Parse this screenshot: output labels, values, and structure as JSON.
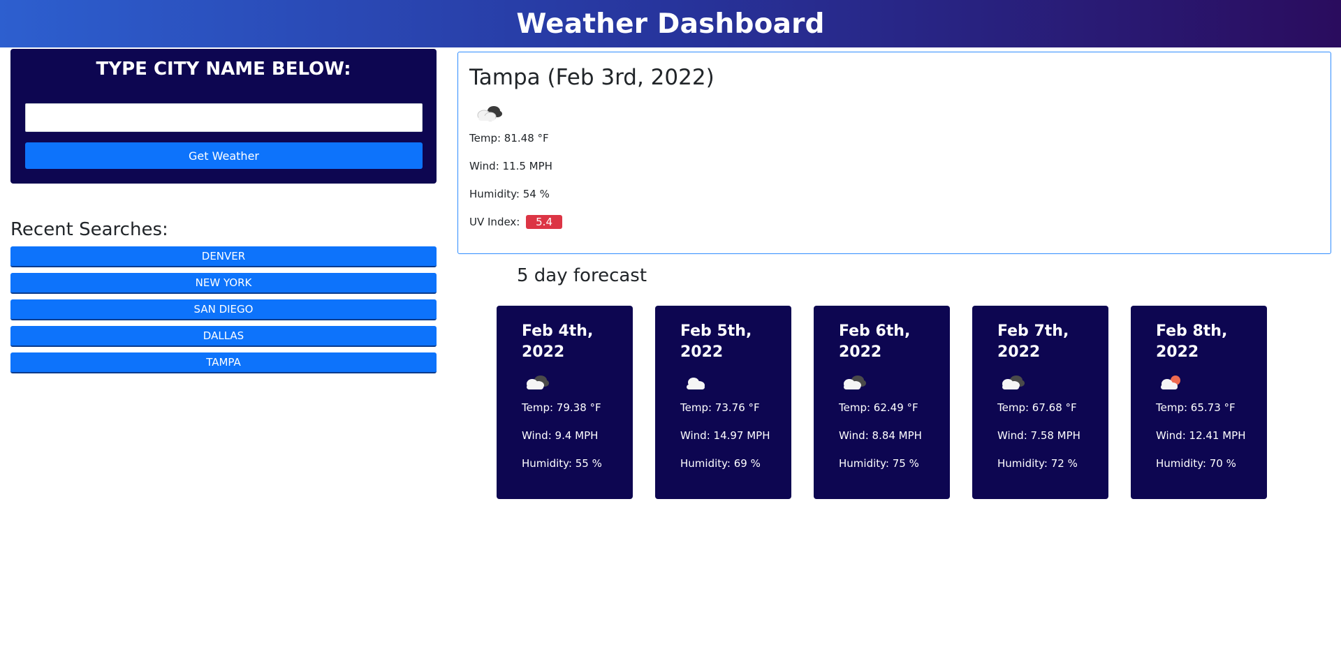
{
  "header": {
    "title": "Weather Dashboard"
  },
  "search": {
    "title": "TYPE CITY NAME BELOW:",
    "input_value": "",
    "button_label": "Get Weather"
  },
  "recent": {
    "title": "Recent Searches:",
    "items": [
      "DENVER",
      "NEW YORK",
      "SAN DIEGO",
      "DALLAS",
      "TAMPA"
    ]
  },
  "current": {
    "city_date": "Tampa (Feb 3rd, 2022)",
    "icon": "partly-cloudy-night-icon",
    "temp": "Temp: 81.48 °F",
    "wind": "Wind: 11.5 MPH",
    "humidity": "Humidity: 54 %",
    "uv_label": "UV Index:",
    "uv_value": "5.4",
    "uv_color": "#dc3545"
  },
  "forecast": {
    "title": "5 day forecast",
    "days": [
      {
        "date": "Feb 4th, 2022",
        "icon": "broken-clouds-icon",
        "temp": "Temp: 79.38 °F",
        "wind": "Wind: 9.4 MPH",
        "humidity": "Humidity: 55 %"
      },
      {
        "date": "Feb 5th, 2022",
        "icon": "cloud-icon",
        "temp": "Temp: 73.76 °F",
        "wind": "Wind: 14.97 MPH",
        "humidity": "Humidity: 69 %"
      },
      {
        "date": "Feb 6th, 2022",
        "icon": "broken-clouds-icon",
        "temp": "Temp: 62.49 °F",
        "wind": "Wind: 8.84 MPH",
        "humidity": "Humidity: 75 %"
      },
      {
        "date": "Feb 7th, 2022",
        "icon": "broken-clouds-icon",
        "temp": "Temp: 67.68 °F",
        "wind": "Wind: 7.58 MPH",
        "humidity": "Humidity: 72 %"
      },
      {
        "date": "Feb 8th, 2022",
        "icon": "partly-cloudy-day-icon",
        "temp": "Temp: 65.73 °F",
        "wind": "Wind: 12.41 MPH",
        "humidity": "Humidity: 70 %"
      }
    ]
  },
  "colors": {
    "panel_bg": "#0d0651",
    "button_blue": "#0d73fb",
    "border_blue": "#2f8cff",
    "uv_red": "#dc3545"
  }
}
